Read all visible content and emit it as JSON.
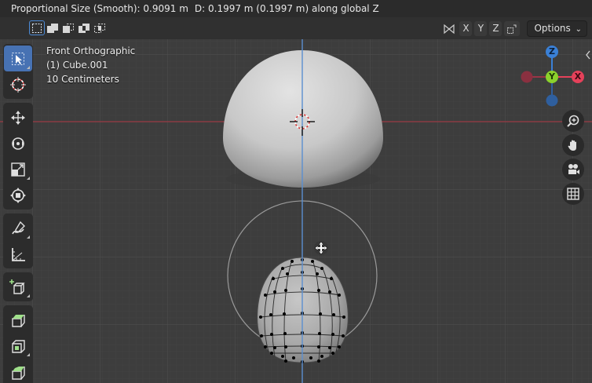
{
  "status": {
    "proportional": "Proportional Size (Smooth): 0.9091 m",
    "distance": "D: 0.1997 m (0.1997 m) along global Z"
  },
  "header": {
    "axes": [
      "X",
      "Y",
      "Z"
    ],
    "options_label": "Options"
  },
  "viewport": {
    "view_name": "Front Orthographic",
    "object_name": "(1) Cube.001",
    "scale": "10 Centimeters"
  },
  "gizmo": {
    "z_label": "Z",
    "y_label": "Y",
    "x_label": "X",
    "colors": {
      "x": "#e5415a",
      "y": "#8bd22c",
      "z": "#3a80d6"
    }
  },
  "toolbar": {
    "tools": [
      "select-box-icon",
      "cursor-icon",
      "move-icon",
      "rotate-icon",
      "scale-icon",
      "transform-icon",
      "annotate-icon",
      "measure-icon",
      "add-cube-icon",
      "extrude-icon",
      "inset-icon",
      "bevel-icon"
    ]
  },
  "nav_buttons": [
    "zoom-icon",
    "pan-hand-icon",
    "camera-icon",
    "grid-icon"
  ],
  "colors": {
    "accent": "#4772b3",
    "axis_x_line": "#9a3a44",
    "axis_z_line": "#5b8fd0"
  }
}
